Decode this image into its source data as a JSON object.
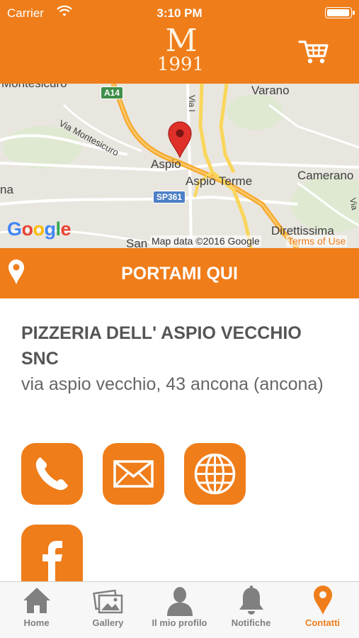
{
  "status_bar": {
    "carrier": "Carrier",
    "time": "3:10 PM",
    "battery_level": 1.0
  },
  "header": {
    "logo_letter": "M",
    "logo_year": "1991",
    "cart_icon": "shopping-cart-icon"
  },
  "map": {
    "labels": {
      "montesicuro_top": "Montesicuro",
      "via_montesicuro": "Via Montesicuro",
      "varano": "Varano",
      "aspio": "Aspio",
      "aspio_terme": "Aspio Terme",
      "camerano": "Camerano",
      "direttissima": "Direttissima",
      "san": "San",
      "na": "na",
      "via_i": "Via I",
      "via_d": "Via"
    },
    "shields": {
      "a14": "A14",
      "sp361": "SP361"
    },
    "google": "Google",
    "attribution": "Map data ©2016 Google",
    "terms": "Terms of Use",
    "colors": {
      "land": "#e9e6df",
      "highway": "#f6a623",
      "road": "#ffffff",
      "green": "#cfe6b9",
      "pin": "#e0302a"
    }
  },
  "navigate": {
    "label": "PORTAMI QUI",
    "icon": "location-pin-icon"
  },
  "business": {
    "name": "PIZZERIA DELL' ASPIO VECCHIO SNC",
    "address": "via aspio vecchio, 43 ancona (ancona)"
  },
  "actions": [
    {
      "name": "phone",
      "icon": "phone-icon"
    },
    {
      "name": "email",
      "icon": "envelope-icon"
    },
    {
      "name": "web",
      "icon": "globe-icon"
    },
    {
      "name": "facebook",
      "icon": "facebook-icon"
    }
  ],
  "tabbar": {
    "tabs": [
      {
        "label": "Home",
        "icon": "home-icon",
        "active": false
      },
      {
        "label": "Gallery",
        "icon": "gallery-icon",
        "active": false
      },
      {
        "label": "Il mio profilo",
        "icon": "profile-icon",
        "active": false
      },
      {
        "label": "Notifiche",
        "icon": "bell-icon",
        "active": false
      },
      {
        "label": "Contatti",
        "icon": "location-pin-icon",
        "active": true
      }
    ]
  },
  "colors": {
    "accent": "#ef7d1a",
    "tab_inactive": "#808080",
    "text_dark": "#555555"
  }
}
